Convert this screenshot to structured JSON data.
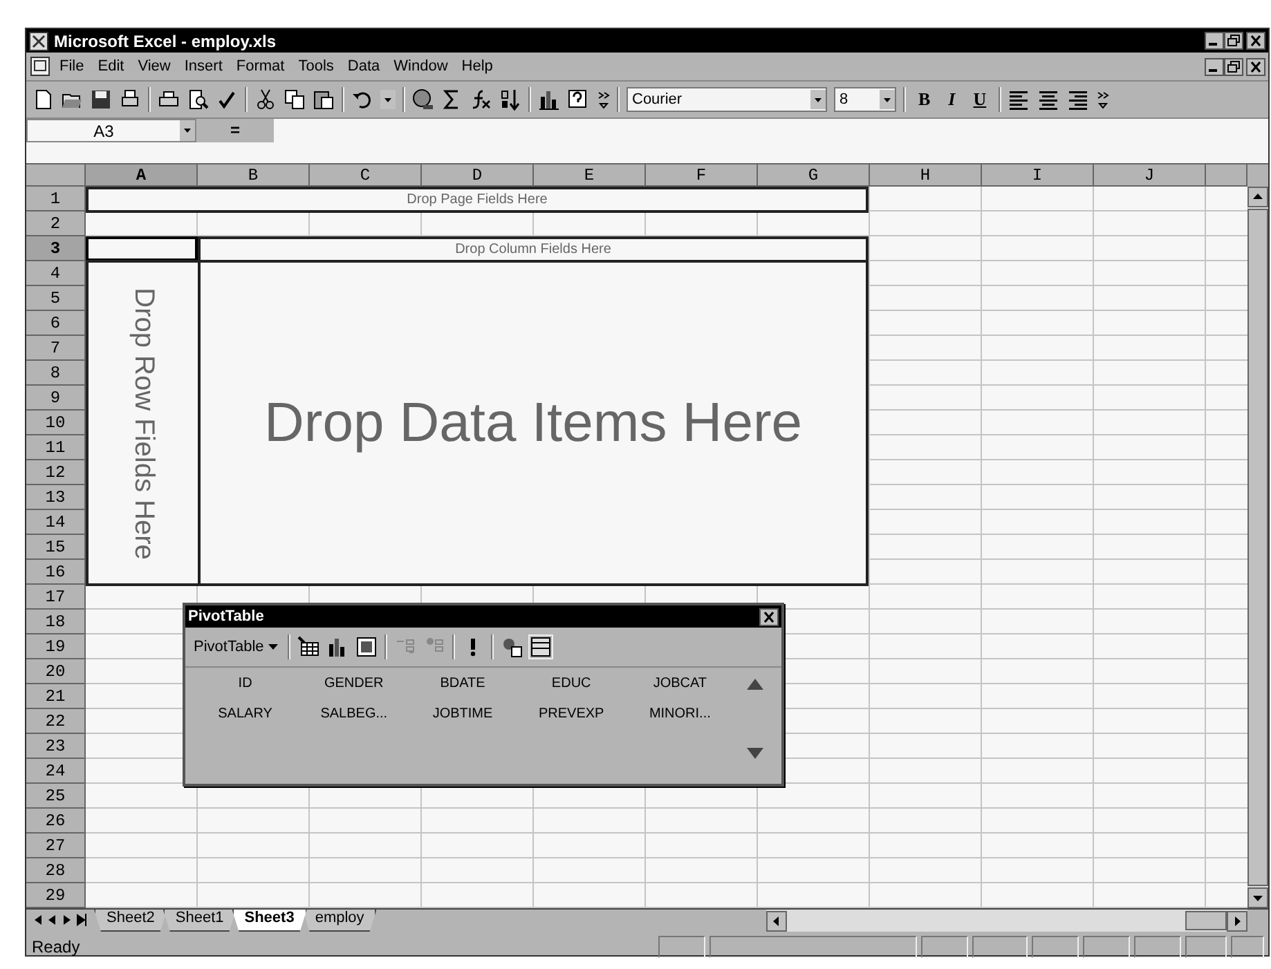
{
  "window": {
    "title": "Microsoft Excel - employ.xls"
  },
  "menu": [
    "File",
    "Edit",
    "View",
    "Insert",
    "Format",
    "Tools",
    "Data",
    "Window",
    "Help"
  ],
  "toolbar": {
    "font": "Courier",
    "font_size": "8",
    "format_buttons": [
      "B",
      "I",
      "U"
    ]
  },
  "formula_bar": {
    "name_box": "A3",
    "equals": "="
  },
  "sheet": {
    "columns": [
      {
        "label": "A",
        "selected": true
      },
      {
        "label": "B",
        "selected": false
      },
      {
        "label": "C",
        "selected": false
      },
      {
        "label": "D",
        "selected": false
      },
      {
        "label": "E",
        "selected": false
      },
      {
        "label": "F",
        "selected": false
      },
      {
        "label": "G",
        "selected": false
      },
      {
        "label": "H",
        "selected": false
      },
      {
        "label": "I",
        "selected": false
      },
      {
        "label": "J",
        "selected": false
      }
    ],
    "rows": [
      {
        "label": "1",
        "selected": false
      },
      {
        "label": "2",
        "selected": false
      },
      {
        "label": "3",
        "selected": true
      },
      {
        "label": "4",
        "selected": false
      },
      {
        "label": "5",
        "selected": false
      },
      {
        "label": "6",
        "selected": false
      },
      {
        "label": "7",
        "selected": false
      },
      {
        "label": "8",
        "selected": false
      },
      {
        "label": "9",
        "selected": false
      },
      {
        "label": "10",
        "selected": false
      },
      {
        "label": "11",
        "selected": false
      },
      {
        "label": "12",
        "selected": false
      },
      {
        "label": "13",
        "selected": false
      },
      {
        "label": "14",
        "selected": false
      },
      {
        "label": "15",
        "selected": false
      },
      {
        "label": "16",
        "selected": false
      },
      {
        "label": "17",
        "selected": false
      },
      {
        "label": "18",
        "selected": false
      },
      {
        "label": "19",
        "selected": false
      },
      {
        "label": "20",
        "selected": false
      },
      {
        "label": "21",
        "selected": false
      },
      {
        "label": "22",
        "selected": false
      },
      {
        "label": "23",
        "selected": false
      },
      {
        "label": "24",
        "selected": false
      },
      {
        "label": "25",
        "selected": false
      },
      {
        "label": "26",
        "selected": false
      },
      {
        "label": "27",
        "selected": false
      },
      {
        "label": "28",
        "selected": false
      },
      {
        "label": "29",
        "selected": false
      }
    ]
  },
  "pivot_areas": {
    "page": "Drop Page Fields Here",
    "column": "Drop Column Fields Here",
    "row": "Drop Row Fields Here",
    "data": "Drop Data Items Here"
  },
  "pivot_toolbar": {
    "title": "PivotTable",
    "menu": "PivotTable",
    "fields": [
      "ID",
      "GENDER",
      "BDATE",
      "EDUC",
      "JOBCAT",
      "SALARY",
      "SALBEG...",
      "JOBTIME",
      "PREVEXP",
      "MINORI..."
    ]
  },
  "sheet_tabs": [
    {
      "label": "Sheet2",
      "selected": false
    },
    {
      "label": "Sheet1",
      "selected": false
    },
    {
      "label": "Sheet3",
      "selected": true
    },
    {
      "label": "employ",
      "selected": false
    }
  ],
  "status_bar": {
    "text": "Ready"
  }
}
